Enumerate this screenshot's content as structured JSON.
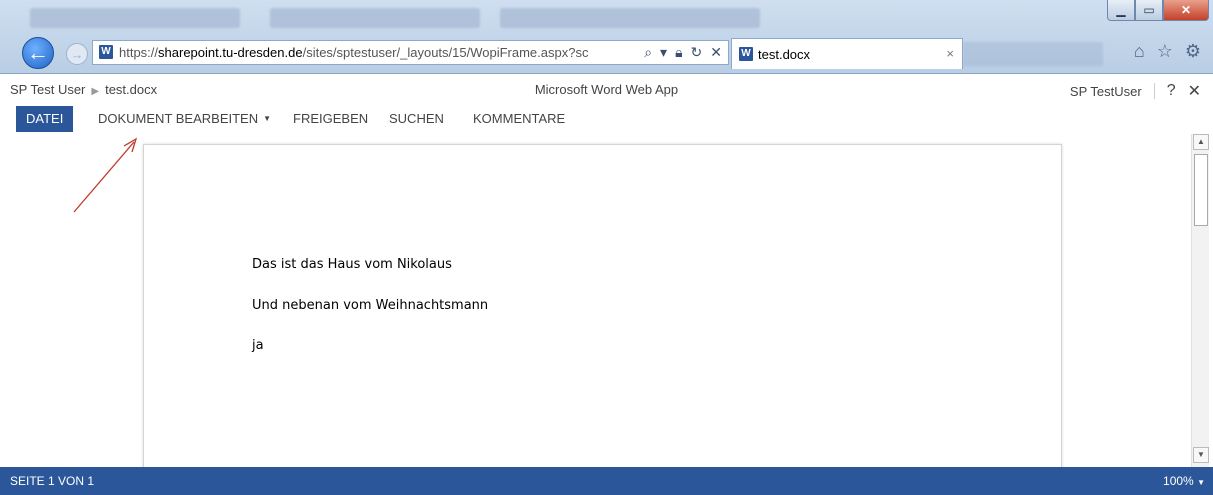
{
  "browser": {
    "address_url_rest": "/sites/sptestuser/_layouts/15/WopiFrame.aspx?sc",
    "address_url_domain": "sharepoint.tu-dresden.de",
    "address_url_scheme": "https://",
    "tab_title": "test.docx",
    "tab_close": "×"
  },
  "app": {
    "breadcrumb_user": "SP Test User",
    "breadcrumb_file": "test.docx",
    "title": "Microsoft Word Web App",
    "user_name": "SP TestUser",
    "help": "?",
    "close": "✕"
  },
  "ribbon": {
    "file": "DATEI",
    "edit": "DOKUMENT BEARBEITEN",
    "share": "FREIGEBEN",
    "search": "SUCHEN",
    "comments": "KOMMENTARE"
  },
  "document": {
    "lines": [
      "Das ist das Haus vom Nikolaus",
      "Und nebenan vom Weihnachtsmann",
      "ja"
    ]
  },
  "status": {
    "page": "SEITE 1 VON 1",
    "zoom": "100%"
  },
  "colors": {
    "accent": "#2b579a",
    "annotation_arrow": "#c0392b"
  }
}
